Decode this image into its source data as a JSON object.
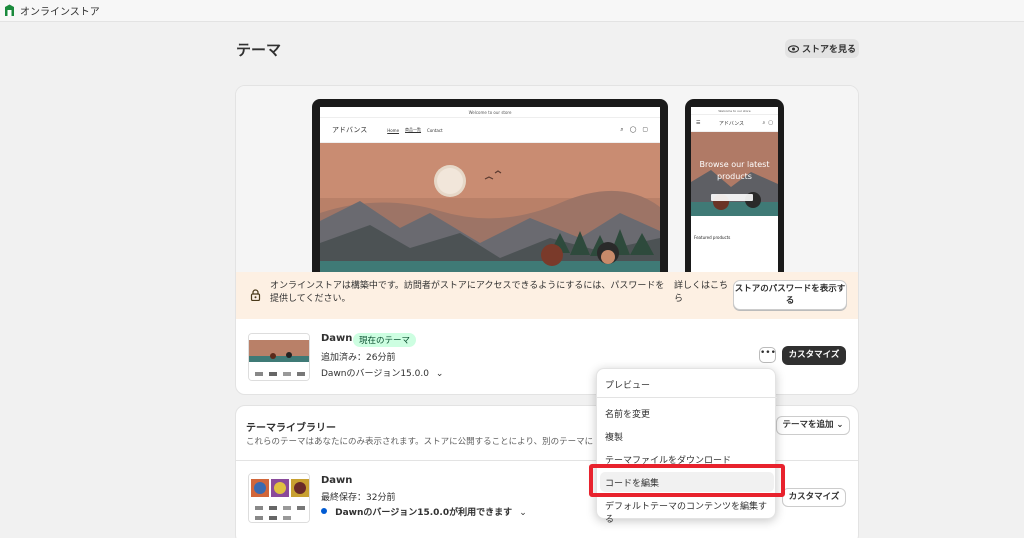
{
  "topbar": {
    "app_title": "オンラインストア"
  },
  "page": {
    "title": "テーマ",
    "view_store_label": "ストアを見る"
  },
  "preview": {
    "announcement": "Welcome to our store",
    "store_name": "アドバンス",
    "nav_links": [
      "Home",
      "商品一覧",
      "Contact"
    ],
    "mobile_hero": "Browse our latest products",
    "mobile_featured": "Featured products"
  },
  "banner": {
    "text": "オンラインストアは構築中です。訪問者がストアにアクセスできるようにするには、パスワードを提供してください。",
    "link": "詳しくはこちら",
    "button": "ストアのパスワードを表示する"
  },
  "current_theme": {
    "name": "Dawn",
    "badge": "現在のテーマ",
    "added": "追加済み：26分前",
    "version": "Dawnのバージョン15.0.0",
    "more_label": "•••",
    "customize_label": "カスタマイズ"
  },
  "library": {
    "title": "テーマライブラリー",
    "description": "これらのテーマはあなたにのみ表示されます。ストアに公開することにより、別のテーマに",
    "add_theme_label": "テーマを追加",
    "items": [
      {
        "name": "Dawn",
        "saved": "最終保存：32分前",
        "version": "Dawnのバージョン15.0.0が利用できます",
        "customize_label": "カスタマイズ"
      }
    ]
  },
  "menu": {
    "items": [
      "プレビュー",
      "名前を変更",
      "複製",
      "テーマファイルをダウンロード",
      "コードを編集",
      "デフォルトテーマのコンテンツを編集する"
    ]
  },
  "colors": {
    "badge_bg": "#cdfee1",
    "banner_bg": "#fdf0e3",
    "highlight": "#e8222d",
    "primary_btn": "#303030"
  }
}
